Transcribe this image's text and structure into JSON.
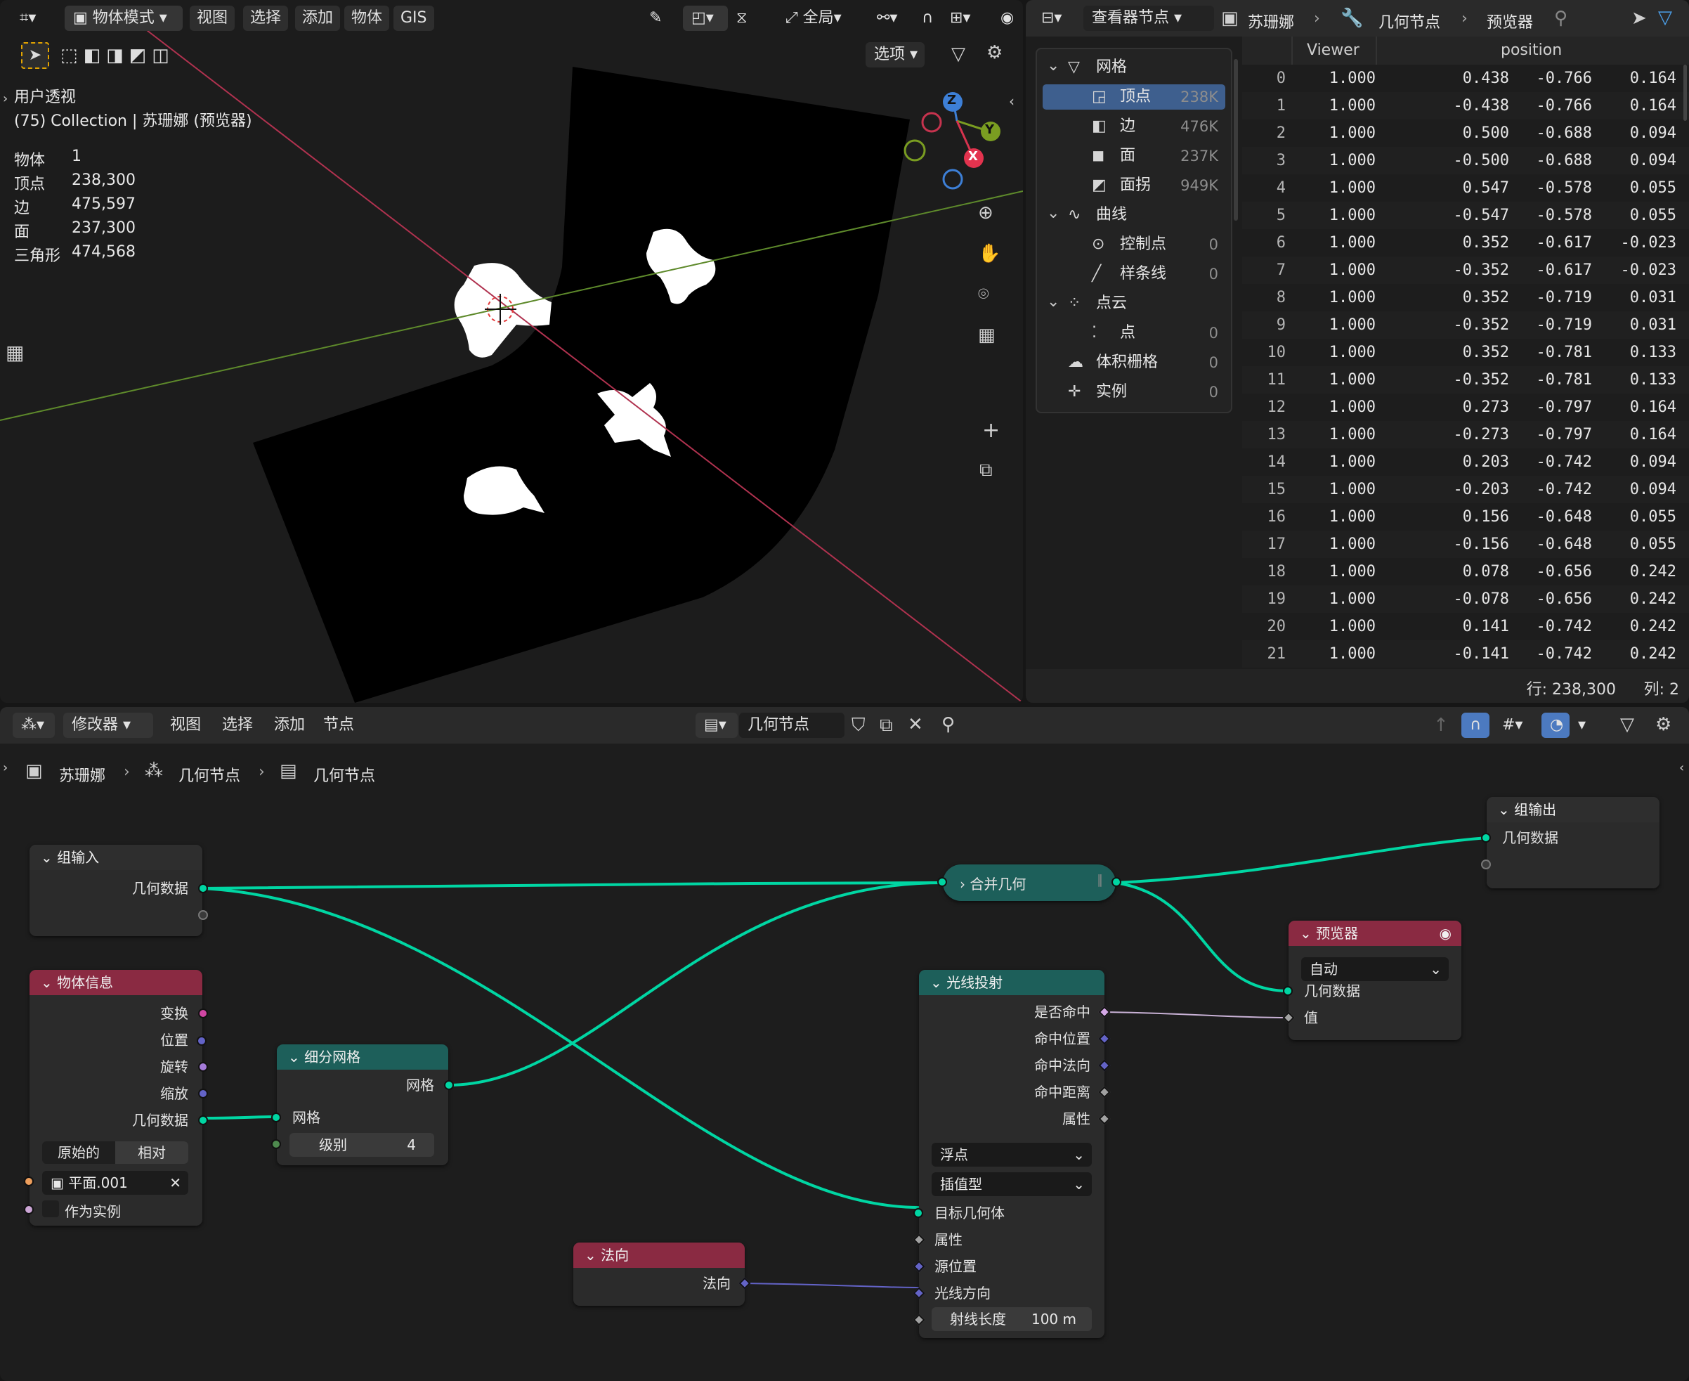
{
  "viewport": {
    "menu": {
      "mode": "物体模式",
      "view": "视图",
      "select": "选择",
      "add": "添加",
      "object": "物体",
      "gis": "GIS"
    },
    "transform_orientation": "全局",
    "options": "选项",
    "overlay_title": "用户透视",
    "overlay_collection": "(75) Collection | 苏珊娜 (预览器)",
    "stats": [
      {
        "label": "物体",
        "value": "1"
      },
      {
        "label": "顶点",
        "value": "238,300"
      },
      {
        "label": "边",
        "value": "475,597"
      },
      {
        "label": "面",
        "value": "237,300"
      },
      {
        "label": "三角形",
        "value": "474,568"
      }
    ],
    "gizmo": {
      "z": "Z",
      "y": "Y",
      "x": "X"
    }
  },
  "spreadsheet": {
    "header": {
      "editor": "查看器节点",
      "object": "苏珊娜",
      "modifier": "几何节点",
      "viewer": "预览器"
    },
    "tree": [
      {
        "label": "网格",
        "count": "",
        "level": 0
      },
      {
        "label": "顶点",
        "count": "238K",
        "level": 1,
        "active": true
      },
      {
        "label": "边",
        "count": "476K",
        "level": 1
      },
      {
        "label": "面",
        "count": "237K",
        "level": 1
      },
      {
        "label": "面拐",
        "count": "949K",
        "level": 1
      },
      {
        "label": "曲线",
        "count": "",
        "level": 0
      },
      {
        "label": "控制点",
        "count": "0",
        "level": 1
      },
      {
        "label": "样条线",
        "count": "0",
        "level": 1
      },
      {
        "label": "点云",
        "count": "",
        "level": 0
      },
      {
        "label": "点",
        "count": "0",
        "level": 1
      },
      {
        "label": "体积栅格",
        "count": "0",
        "level": 0
      },
      {
        "label": "实例",
        "count": "0",
        "level": 0
      }
    ],
    "columns": [
      "Viewer",
      "position"
    ],
    "rows": [
      [
        "0",
        "1.000",
        "0.438",
        "-0.766",
        "0.164"
      ],
      [
        "1",
        "1.000",
        "-0.438",
        "-0.766",
        "0.164"
      ],
      [
        "2",
        "1.000",
        "0.500",
        "-0.688",
        "0.094"
      ],
      [
        "3",
        "1.000",
        "-0.500",
        "-0.688",
        "0.094"
      ],
      [
        "4",
        "1.000",
        "0.547",
        "-0.578",
        "0.055"
      ],
      [
        "5",
        "1.000",
        "-0.547",
        "-0.578",
        "0.055"
      ],
      [
        "6",
        "1.000",
        "0.352",
        "-0.617",
        "-0.023"
      ],
      [
        "7",
        "1.000",
        "-0.352",
        "-0.617",
        "-0.023"
      ],
      [
        "8",
        "1.000",
        "0.352",
        "-0.719",
        "0.031"
      ],
      [
        "9",
        "1.000",
        "-0.352",
        "-0.719",
        "0.031"
      ],
      [
        "10",
        "1.000",
        "0.352",
        "-0.781",
        "0.133"
      ],
      [
        "11",
        "1.000",
        "-0.352",
        "-0.781",
        "0.133"
      ],
      [
        "12",
        "1.000",
        "0.273",
        "-0.797",
        "0.164"
      ],
      [
        "13",
        "1.000",
        "-0.273",
        "-0.797",
        "0.164"
      ],
      [
        "14",
        "1.000",
        "0.203",
        "-0.742",
        "0.094"
      ],
      [
        "15",
        "1.000",
        "-0.203",
        "-0.742",
        "0.094"
      ],
      [
        "16",
        "1.000",
        "0.156",
        "-0.648",
        "0.055"
      ],
      [
        "17",
        "1.000",
        "-0.156",
        "-0.648",
        "0.055"
      ],
      [
        "18",
        "1.000",
        "0.078",
        "-0.656",
        "0.242"
      ],
      [
        "19",
        "1.000",
        "-0.078",
        "-0.656",
        "0.242"
      ],
      [
        "20",
        "1.000",
        "0.141",
        "-0.742",
        "0.242"
      ],
      [
        "21",
        "1.000",
        "-0.141",
        "-0.742",
        "0.242"
      ]
    ],
    "footer": {
      "rows": "行: 238,300",
      "cols": "列: 2"
    }
  },
  "node_editor": {
    "menu": {
      "modifier": "修改器",
      "view": "视图",
      "select": "选择",
      "add": "添加",
      "node": "节点"
    },
    "tree_name": "几何节点",
    "breadcrumb": [
      "苏珊娜",
      "几何节点",
      "几何节点"
    ],
    "nodes": {
      "group_input": {
        "title": "组输入",
        "geometry": "几何数据"
      },
      "object_info": {
        "title": "物体信息",
        "transform": "变换",
        "location": "位置",
        "rotation": "旋转",
        "scale": "缩放",
        "geometry": "几何数据",
        "original": "原始的",
        "relative": "相对",
        "object": "平面.001",
        "as_instance": "作为实例"
      },
      "subdivide": {
        "title": "细分网格",
        "mesh_out": "网格",
        "mesh_in": "网格",
        "level_label": "级别",
        "level_value": "4"
      },
      "normal": {
        "title": "法向",
        "normal": "法向"
      },
      "join": {
        "title": "合并几何"
      },
      "raycast": {
        "title": "光线投射",
        "is_hit": "是否命中",
        "hit_position": "命中位置",
        "hit_normal": "命中法向",
        "hit_distance": "命中距离",
        "attribute_out": "属性",
        "data_type": "浮点",
        "mapping": "插值型",
        "target": "目标几何体",
        "attribute_in": "属性",
        "source_position": "源位置",
        "ray_direction": "光线方向",
        "ray_length_label": "射线长度",
        "ray_length_value": "100 m"
      },
      "viewer": {
        "title": "预览器",
        "domain": "自动",
        "geometry": "几何数据",
        "value": "值"
      },
      "group_output": {
        "title": "组输出",
        "geometry": "几何数据"
      }
    }
  },
  "colors": {
    "geometry_socket": "#00d6a3",
    "vector_socket": "#6363c7",
    "object_header": "#8a2a42",
    "geometry_header": "#1d5f5a"
  }
}
